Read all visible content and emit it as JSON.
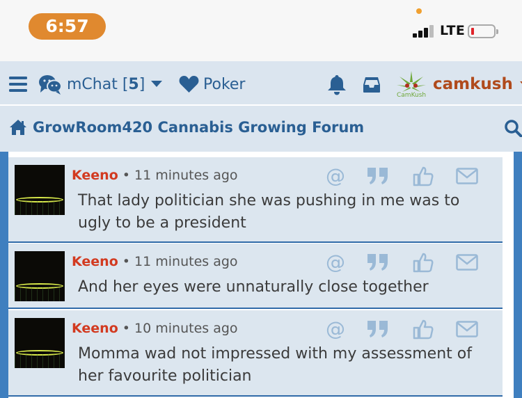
{
  "status_bar": {
    "time": "6:57",
    "network": "LTE"
  },
  "nav": {
    "chat_label": "mChat [",
    "chat_count": "5",
    "chat_close": "]",
    "poker_label": "Poker",
    "username": "camkush",
    "logo_caption": "CamKush"
  },
  "breadcrumb": {
    "title": "GrowRoom420 Cannabis Growing Forum"
  },
  "messages": [
    {
      "user": "Keeno",
      "time": "11 minutes ago",
      "text": "That lady politician she was pushing in me was to ugly to be a president"
    },
    {
      "user": "Keeno",
      "time": "11 minutes ago",
      "text": "And her eyes were unnaturally close together"
    },
    {
      "user": "Keeno",
      "time": "10 minutes ago",
      "text": "Momma wad not impressed with my assessment of her favourite politician"
    }
  ],
  "colors": {
    "nav_bg": "#dbe5ef",
    "link": "#2a5f93",
    "username": "#b04a1c",
    "post_user": "#d23a20",
    "frame": "#3f7fbf",
    "icon": "#9ab9d6"
  }
}
